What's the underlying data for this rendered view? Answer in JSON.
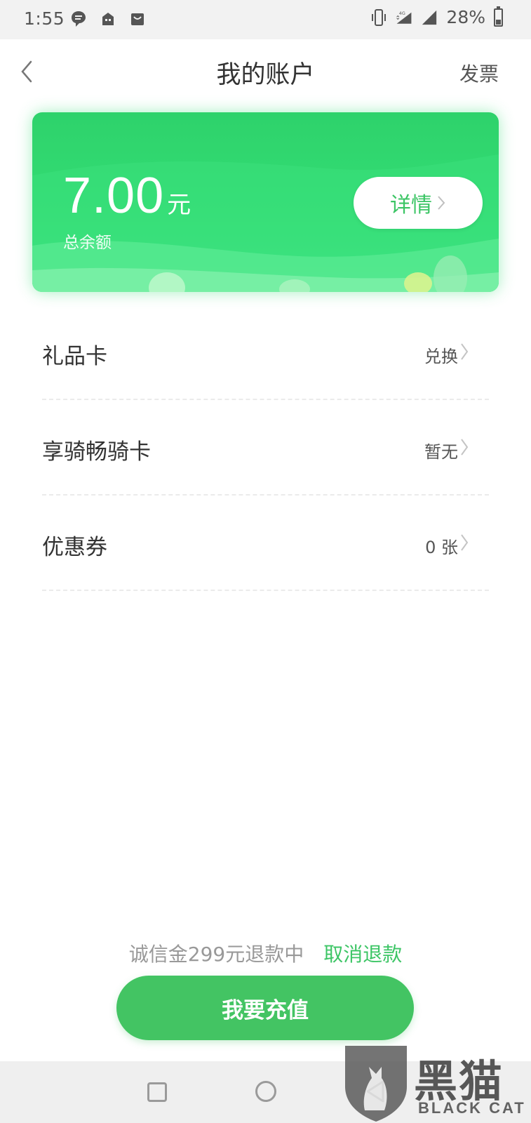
{
  "status_bar": {
    "time": "1:55",
    "battery": "28%",
    "network": "4G",
    "icons": [
      "message-icon",
      "store-icon",
      "shopping-bag-icon",
      "vibrate-icon",
      "signal-4g-icon",
      "signal-icon",
      "battery-icon"
    ]
  },
  "header": {
    "title": "我的账户",
    "right_link": "发票",
    "back_icon": "chevron-left-icon"
  },
  "balance_card": {
    "amount": "7.00",
    "unit": "元",
    "label": "总余额",
    "details_label": "详情",
    "background_color": "#2ed26b"
  },
  "list": {
    "items": [
      {
        "label": "礼品卡",
        "value": "兑换"
      },
      {
        "label": "享骑畅骑卡",
        "value": "暂无"
      },
      {
        "label": "优惠券",
        "value": "0 张"
      }
    ]
  },
  "footer": {
    "deposit_status": "诚信金299元退款中",
    "cancel_refund": "取消退款",
    "recharge_label": "我要充值",
    "accent_color": "#43c463"
  },
  "watermark": {
    "chars": "黑猫",
    "text": "BLACK CAT"
  }
}
